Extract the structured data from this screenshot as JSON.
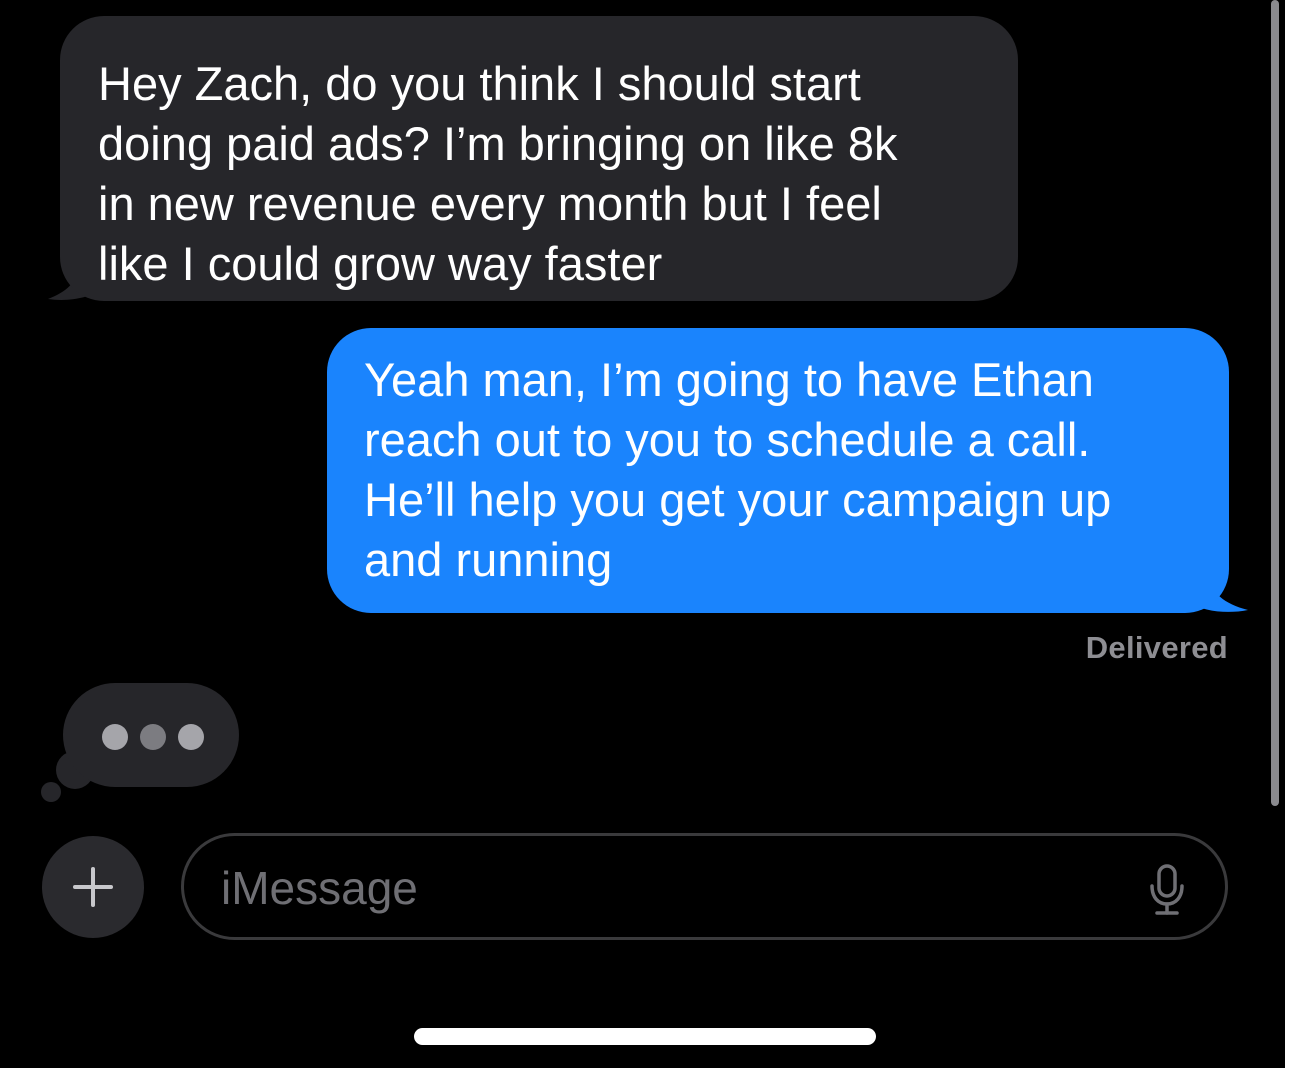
{
  "messages": [
    {
      "direction": "incoming",
      "lines": [
        "Hey Zach, do you think I should start",
        "doing paid ads? I’m bringing on like 8k",
        "in new revenue every month but I feel",
        "like I could grow way faster"
      ]
    },
    {
      "direction": "outgoing",
      "lines": [
        "Yeah man, I’m going to have Ethan",
        "reach out to you to schedule a call.",
        "He’ll help you get your campaign up",
        "and running"
      ]
    }
  ],
  "status": {
    "delivered_label": "Delivered"
  },
  "typing_indicator": {
    "visible": true
  },
  "composer": {
    "placeholder": "iMessage",
    "plus_icon": "plus-icon",
    "mic_icon": "microphone-icon"
  },
  "colors": {
    "background": "#000000",
    "incoming_bubble": "#26262a",
    "outgoing_bubble": "#1a84fd",
    "secondary_text": "#8e8e93"
  }
}
